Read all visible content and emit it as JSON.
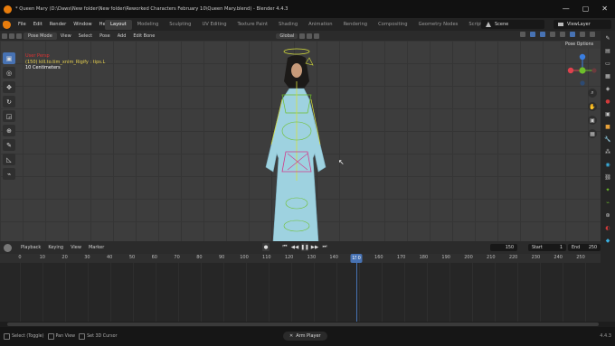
{
  "window": {
    "title": "* Queen Mary (D:\\Daws\\New folder\\New folder\\Reworked Characters February 10\\Queen Mary.blend) - Blender 4.4.3",
    "minimize": "—",
    "maximize": "▢",
    "close": "✕"
  },
  "menubar": {
    "items": [
      "File",
      "Edit",
      "Render",
      "Window",
      "Help"
    ],
    "workspaces": [
      "Layout",
      "Modeling",
      "Sculpting",
      "UV Editing",
      "Texture Paint",
      "Shading",
      "Animation",
      "Rendering",
      "Compositing",
      "Geometry Nodes",
      "Scripting"
    ],
    "active_workspace": "Layout",
    "add_workspace": "+",
    "scene": "Scene",
    "view_layer": "ViewLayer"
  },
  "viewport_header": {
    "mode": "Pose Mode",
    "menus": [
      "View",
      "Select",
      "Pose",
      "Add",
      "Edit Bone"
    ],
    "transform_orientation": "Global",
    "pose_options": "Pose Options"
  },
  "viewport": {
    "info_mode": "User Persp",
    "info_object": "(150) kill.to.tim_xnim_Rigify : tips.L",
    "info_scale": "10 Centimeters",
    "gizmo_colors": {
      "x": "#e0424d",
      "y": "#6ebf2b",
      "z": "#3a7ee0"
    }
  },
  "timeline": {
    "menus": [
      "Playback",
      "Keying",
      "View",
      "Marker"
    ],
    "current_frame": "150",
    "start_label": "Start",
    "start": "1",
    "end_label": "End",
    "end": "250",
    "ruler": [
      "0",
      "10",
      "20",
      "30",
      "40",
      "50",
      "60",
      "70",
      "80",
      "90",
      "100",
      "110",
      "120",
      "130",
      "140",
      "150",
      "160",
      "170",
      "180",
      "190",
      "200",
      "210",
      "220",
      "230",
      "240",
      "250"
    ]
  },
  "statusbar": {
    "select": "Select (Toggle)",
    "pan": "Pan View",
    "cursor": "Set 3D Cursor",
    "armature": "Arm Player",
    "version": "4.4.3"
  },
  "colors": {
    "accent": "#4772b3",
    "blender_orange": "#e87d0d",
    "viewport_bg": "#3d3d3d",
    "rig_yellow": "#d8e03a",
    "rig_magenta": "#d23a8a",
    "dress": "#9ed2e0"
  },
  "icons": [
    "blender-logo",
    "select-box-icon",
    "cursor-icon",
    "move-icon",
    "rotate-icon",
    "scale-icon",
    "transform-icon",
    "annotate-icon",
    "measure-icon",
    "bone-icon",
    "zoom-icon",
    "hand-icon",
    "camera-icon",
    "grid-icon",
    "play-icon",
    "jump-start-icon",
    "jump-end-icon",
    "keyframe-prev-icon",
    "keyframe-next-icon",
    "clock-icon",
    "mouse-icon",
    "armature-icon"
  ]
}
